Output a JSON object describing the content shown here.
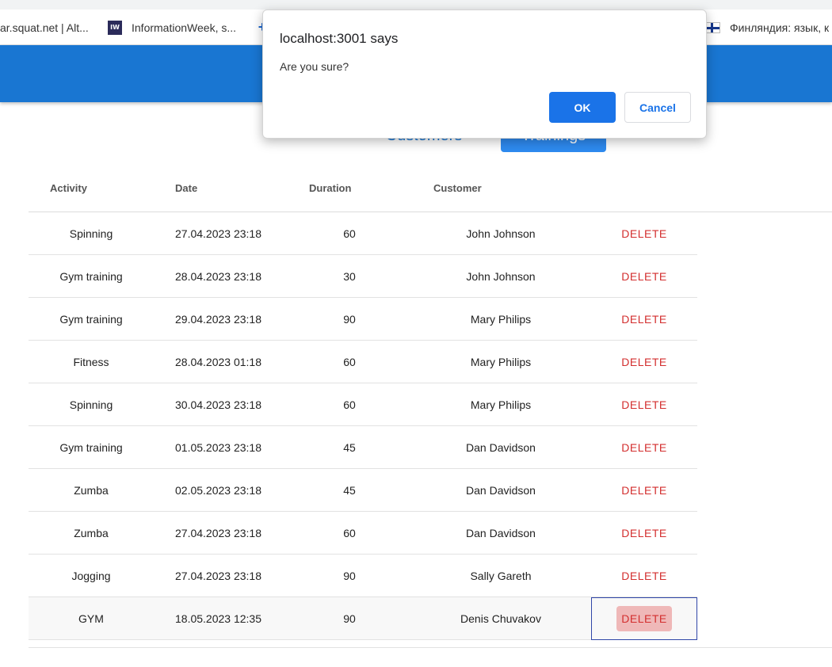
{
  "bookmarks": [
    {
      "label": "ar.squat.net | Alt...",
      "icon": "none"
    },
    {
      "label": "InformationWeek, s...",
      "icon": "informationweek-icon",
      "icon_text": "IW"
    },
    {
      "label": "",
      "icon": "plus-icon",
      "icon_text": "+"
    },
    {
      "label": "Финляндия: язык, к",
      "icon": "finland-flag-icon"
    }
  ],
  "nav": {
    "customers_label": "Customers",
    "trainings_label": "Trainings"
  },
  "table": {
    "columns": [
      "Activity",
      "Date",
      "Duration",
      "Customer"
    ],
    "action_label": "DELETE",
    "rows": [
      {
        "activity": "Spinning",
        "date": "27.04.2023 23:18",
        "duration": "60",
        "customer": "John Johnson"
      },
      {
        "activity": "Gym training",
        "date": "28.04.2023 23:18",
        "duration": "30",
        "customer": "John Johnson"
      },
      {
        "activity": "Gym training",
        "date": "29.04.2023 23:18",
        "duration": "90",
        "customer": "Mary Philips"
      },
      {
        "activity": "Fitness",
        "date": "28.04.2023 01:18",
        "duration": "60",
        "customer": "Mary Philips"
      },
      {
        "activity": "Spinning",
        "date": "30.04.2023 23:18",
        "duration": "60",
        "customer": "Mary Philips"
      },
      {
        "activity": "Gym training",
        "date": "01.05.2023 23:18",
        "duration": "45",
        "customer": "Dan Davidson"
      },
      {
        "activity": "Zumba",
        "date": "02.05.2023 23:18",
        "duration": "45",
        "customer": "Dan Davidson"
      },
      {
        "activity": "Zumba",
        "date": "27.04.2023 23:18",
        "duration": "60",
        "customer": "Dan Davidson"
      },
      {
        "activity": "Jogging",
        "date": "27.04.2023 23:18",
        "duration": "90",
        "customer": "Sally Gareth"
      },
      {
        "activity": "GYM",
        "date": "18.05.2023 12:35",
        "duration": "90",
        "customer": "Denis Chuvakov"
      }
    ]
  },
  "dialog": {
    "title": "localhost:3001 says",
    "message": "Are you sure?",
    "ok_label": "OK",
    "cancel_label": "Cancel"
  },
  "colors": {
    "appbar": "#1976d2",
    "delete": "#d32f2f",
    "dialog_primary": "#1a73e8"
  }
}
